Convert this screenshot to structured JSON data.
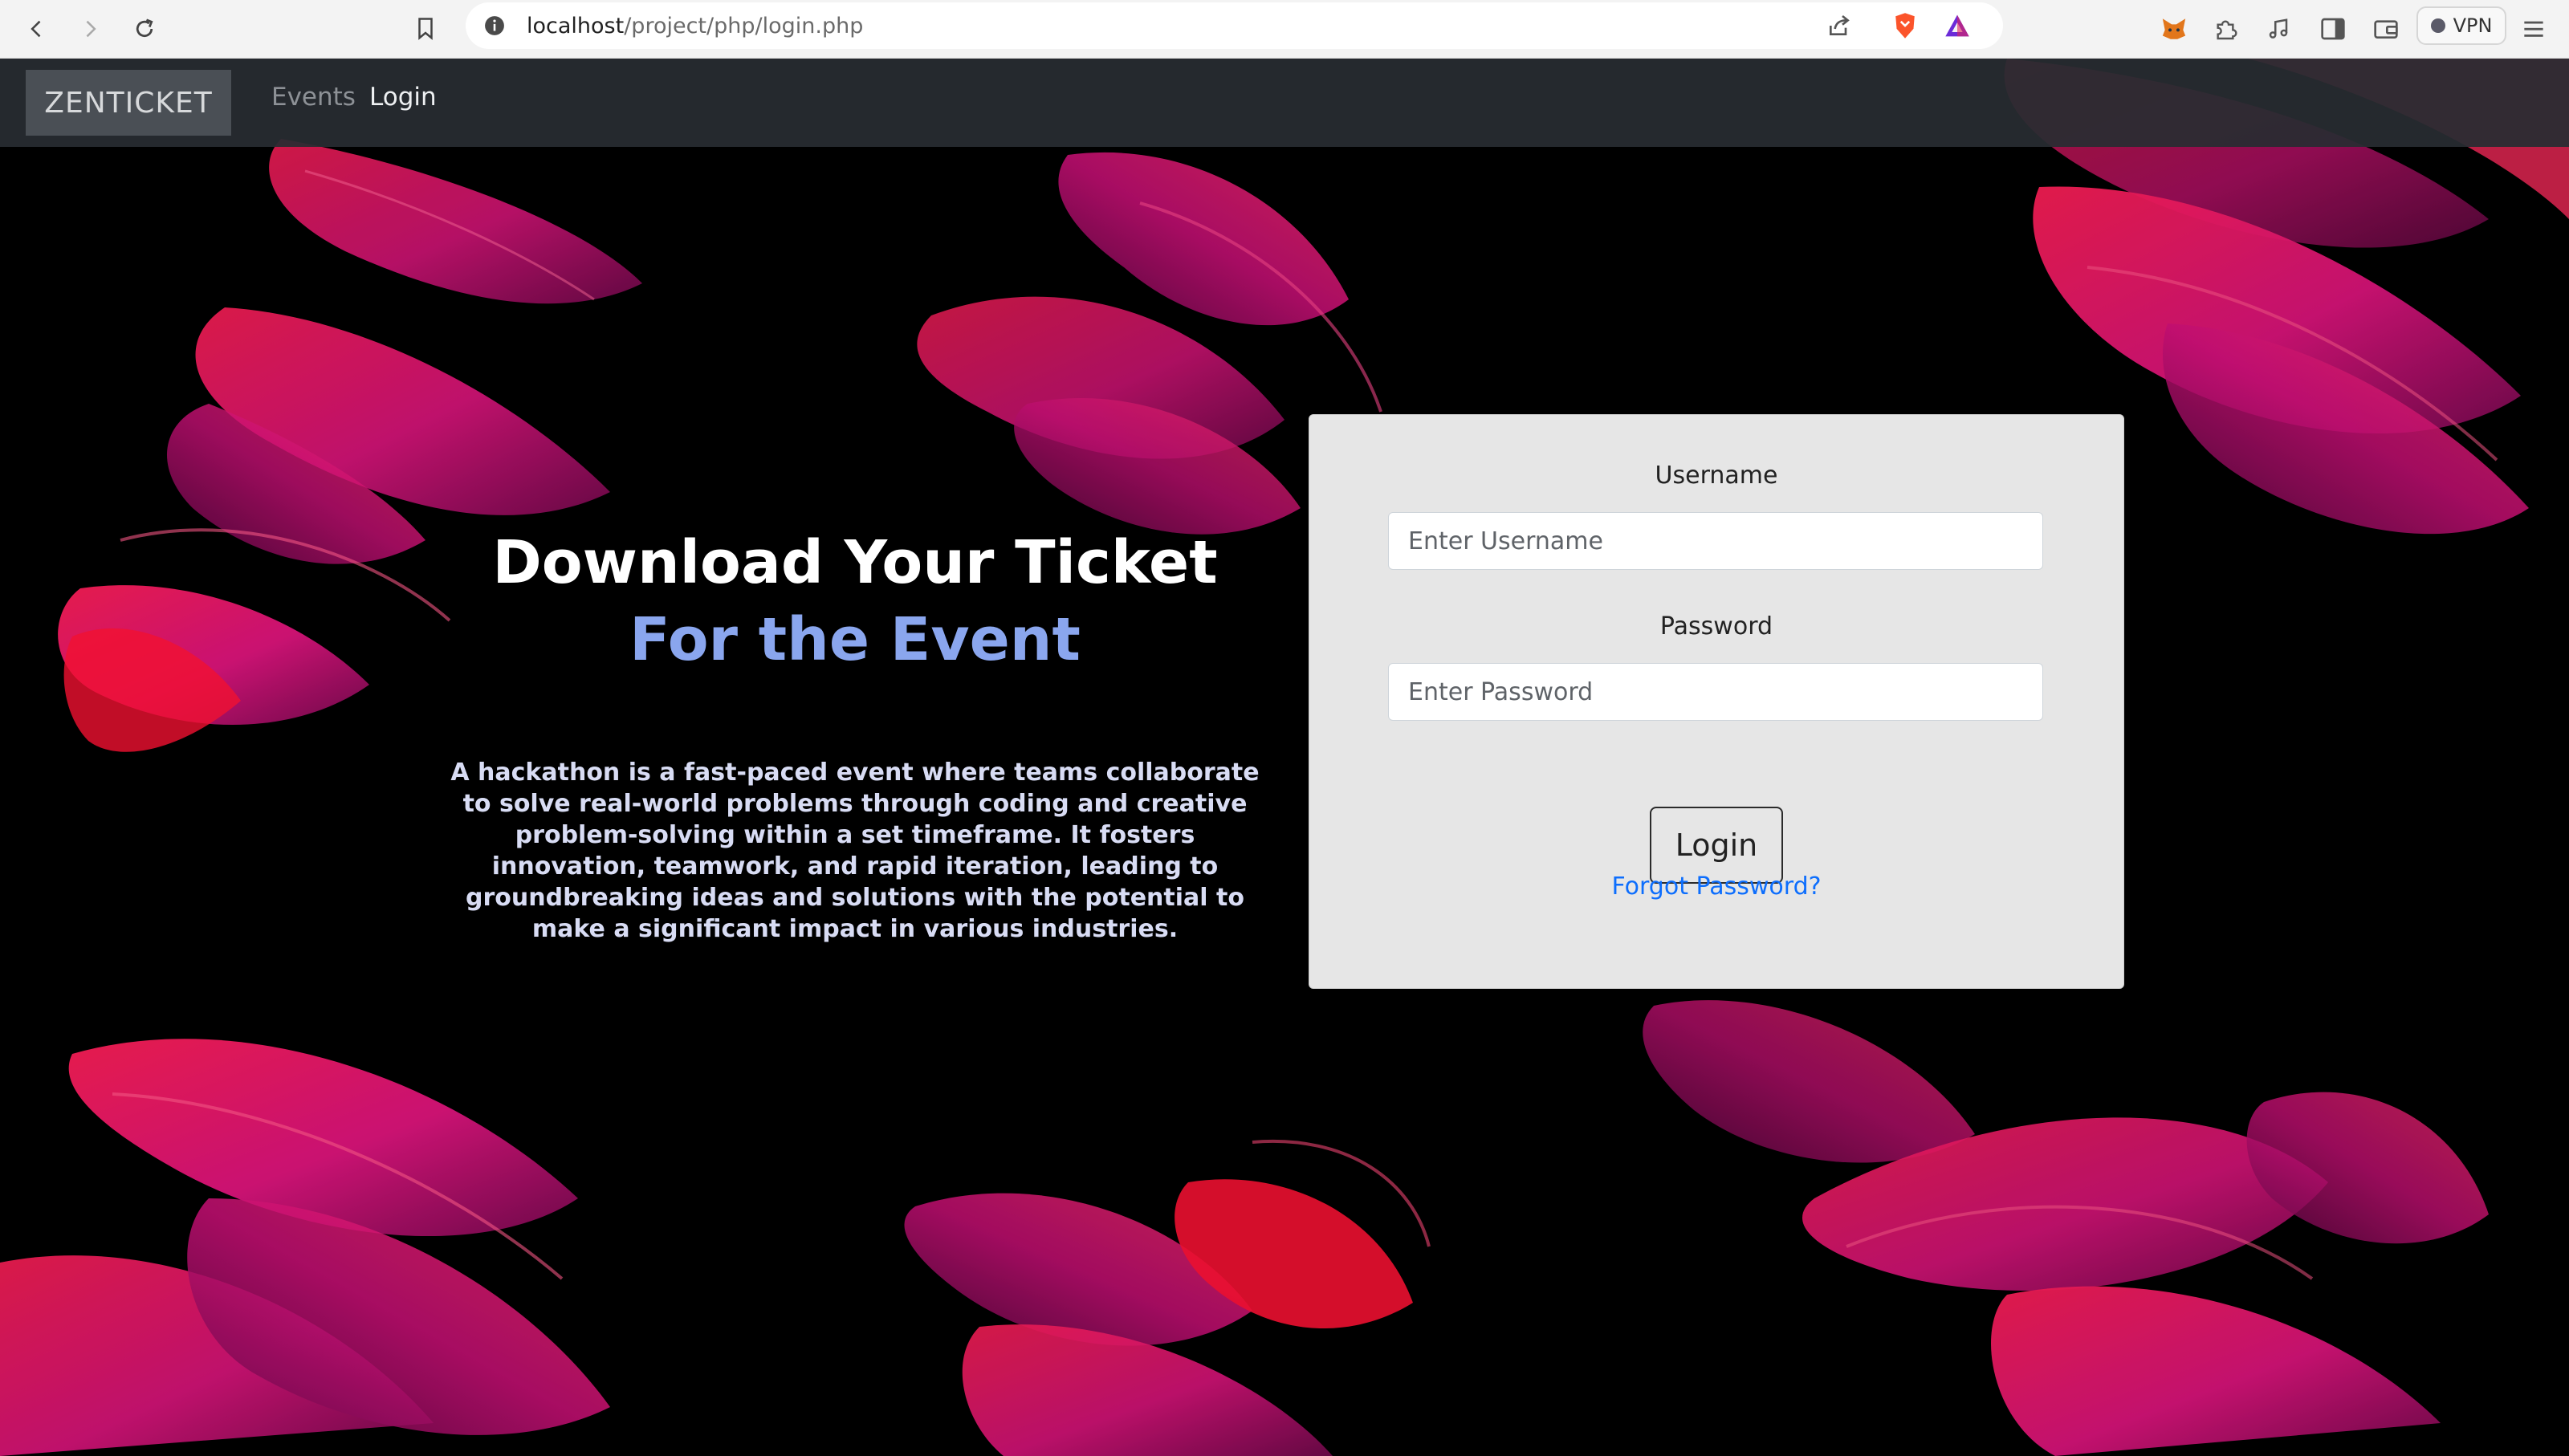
{
  "browser": {
    "url_host": "localhost",
    "url_path": "/project/php/login.php",
    "vpn_label": "VPN",
    "icons": [
      "back-icon",
      "forward-icon",
      "reload-icon",
      "bookmark-icon",
      "site-info-icon",
      "share-icon",
      "brave-shield-icon",
      "rewards-icon",
      "metamask-icon",
      "extensions-icon",
      "media-icon",
      "sidebar-icon",
      "wallet-icon",
      "menu-icon"
    ]
  },
  "navbar": {
    "brand": "ZENTICKET",
    "links": [
      "Events",
      "Login"
    ]
  },
  "hero": {
    "title_line1": "Download Your Ticket",
    "title_line2": "For the Event",
    "description": "A hackathon is a fast-paced event where teams collaborate to solve real-world problems through coding and creative problem-solving within a set timeframe. It fosters innovation, teamwork, and rapid iteration, leading to groundbreaking ideas and solutions with the potential to make a significant impact in various industries."
  },
  "login_form": {
    "username_label": "Username",
    "username_placeholder": "Enter Username",
    "password_label": "Password",
    "password_placeholder": "Enter Password",
    "submit_label": "Login",
    "forgot_link": "Forgot Password?"
  },
  "colors": {
    "accent_blue": "#8aa6ee",
    "link_blue": "#0d6efd",
    "ribbon_pink": "#ff1a5e",
    "ribbon_magenta": "#e0147e"
  }
}
